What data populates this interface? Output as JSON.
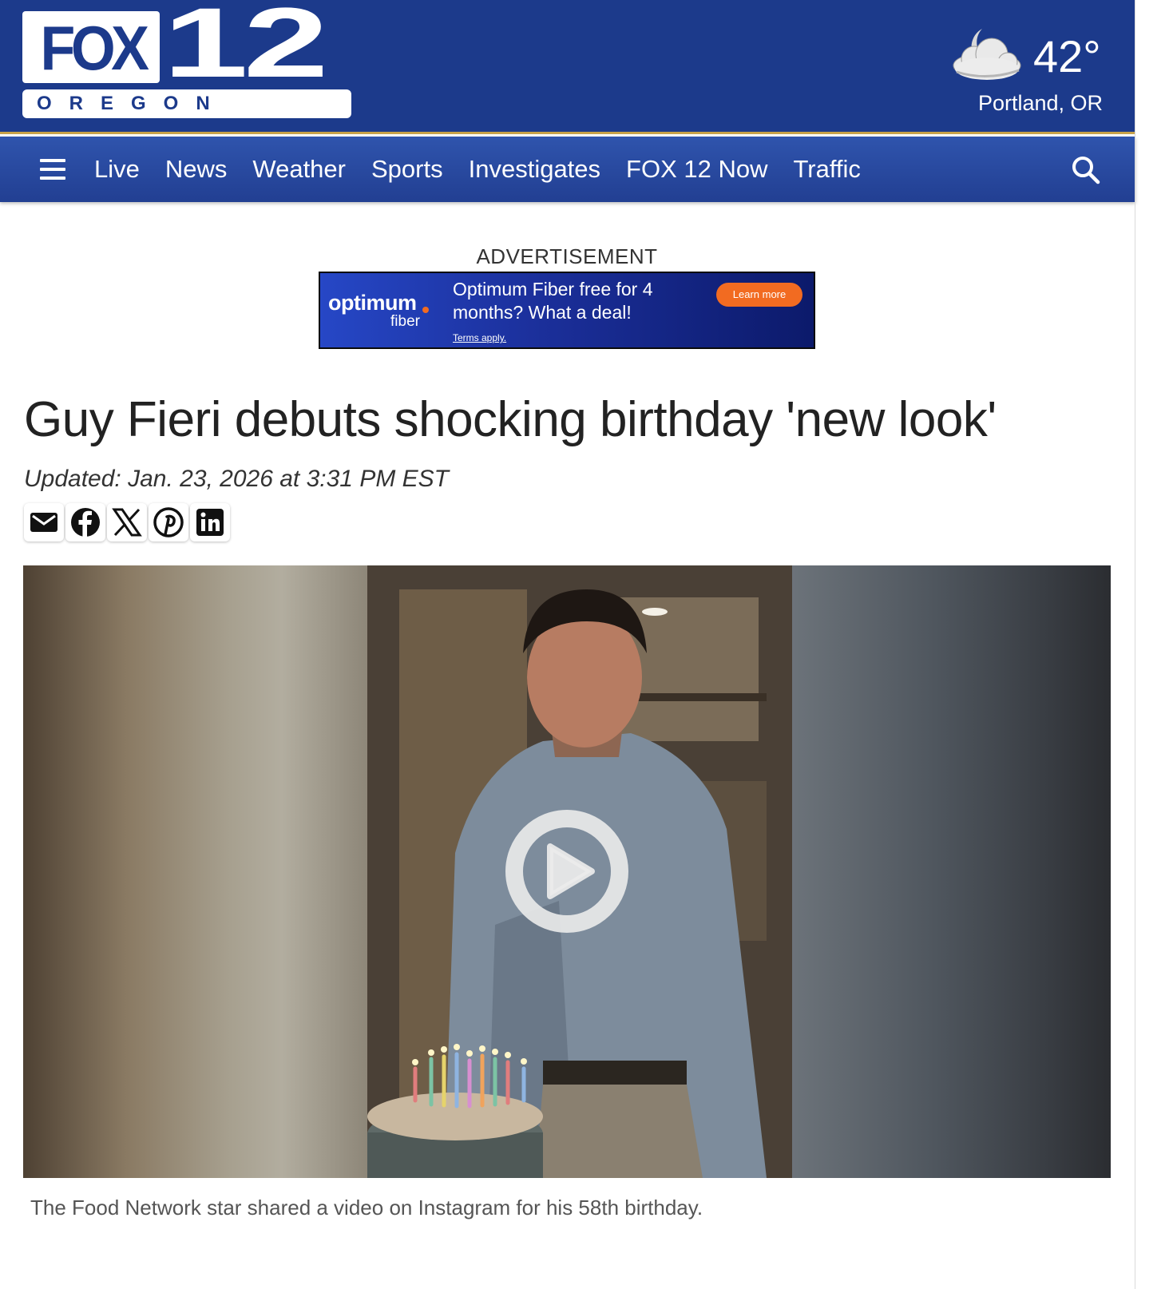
{
  "header": {
    "logo": {
      "brand": "FOX",
      "number": "12",
      "region": "OREGON"
    },
    "weather": {
      "icon": "partly-cloudy-night-icon",
      "temperature": "42°",
      "city": "Portland, OR"
    }
  },
  "nav": {
    "menu_icon": "hamburger-menu-icon",
    "items": [
      "Live",
      "News",
      "Weather",
      "Sports",
      "Investigates",
      "FOX 12 Now",
      "Traffic"
    ],
    "search_icon": "search-icon"
  },
  "ad": {
    "label": "ADVERTISEMENT",
    "brand": "optimum",
    "brand_sub": "fiber",
    "headline": "Optimum Fiber free for 4 months? What a deal!",
    "terms": "Terms apply.",
    "cta": "Learn more"
  },
  "article": {
    "headline": "Guy Fieri debuts shocking birthday 'new look'",
    "updated": "Updated: Jan. 23, 2026 at 3:31 PM EST",
    "share_icons": [
      "email-icon",
      "facebook-icon",
      "x-icon",
      "pinterest-icon",
      "linkedin-icon"
    ],
    "video": {
      "play_icon": "play-icon"
    },
    "caption": "The Food Network star shared a video on Instagram for his 58th birthday."
  },
  "colors": {
    "header_bg": "#1c3a8b",
    "nav_bg": "#2a4ba3",
    "accent_gold": "#c7a24a",
    "ad_cta": "#f26b21"
  }
}
